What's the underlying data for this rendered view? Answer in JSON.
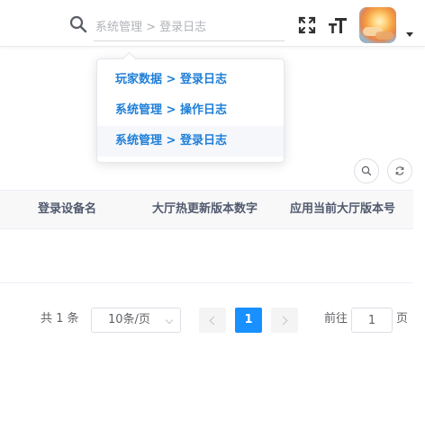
{
  "header": {
    "search_placeholder": "系统管理 > 登录日志",
    "icons": [
      "search-icon",
      "fullscreen-icon",
      "font-size-icon",
      "avatar",
      "caret-down-icon"
    ]
  },
  "dropdown": {
    "items": [
      {
        "label": "玩家数据 > 登录日志"
      },
      {
        "label": "系统管理 > 操作日志"
      },
      {
        "label": "系统管理 > 登录日志"
      }
    ]
  },
  "toolbar": {
    "icons": [
      "search-icon",
      "refresh-icon"
    ]
  },
  "table": {
    "columns": [
      "登录设备名",
      "大厅热更新版本数字",
      "应用当前大厅版本号"
    ]
  },
  "pagination": {
    "total_label": "共 1 条",
    "page_size_label": "10条/页",
    "current_page": "1",
    "goto_label": "前往",
    "goto_value": "1",
    "page_suffix": "页"
  },
  "colors": {
    "accent": "#1890ff",
    "link": "#1f7fd8"
  }
}
